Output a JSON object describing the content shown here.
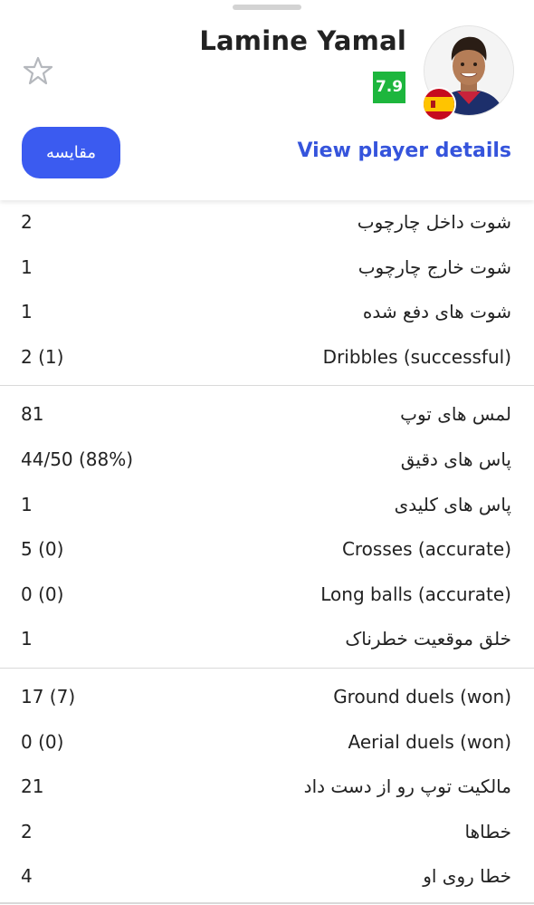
{
  "player": {
    "name": "Lamine Yamal",
    "rating": "7.9",
    "rating_color": "#1db63d",
    "nationality_flag": "spain-flag-icon"
  },
  "actions": {
    "compare_label": "مقایسه",
    "details_label": "View player details",
    "accent_color": "#3b5bf0"
  },
  "stats_groups": [
    {
      "rows": [
        {
          "label": "شوت داخل چارچوب",
          "value": "2"
        },
        {
          "label": "شوت خارج چارچوب",
          "value": "1"
        },
        {
          "label": "شوت های دفع شده",
          "value": "1"
        },
        {
          "label": "Dribbles (successful)",
          "value": "2 (1)"
        }
      ]
    },
    {
      "rows": [
        {
          "label": "لمس های توپ",
          "value": "81"
        },
        {
          "label": "پاس های دقیق",
          "value": "44/50 (88%)"
        },
        {
          "label": "پاس های کلیدی",
          "value": "1"
        },
        {
          "label": "Crosses (accurate)",
          "value": "5 (0)"
        },
        {
          "label": "Long balls (accurate)",
          "value": "0 (0)"
        },
        {
          "label": "خلق موقعیت خطرناک",
          "value": "1"
        }
      ]
    },
    {
      "rows": [
        {
          "label": "Ground duels (won)",
          "value": "17 (7)"
        },
        {
          "label": "Aerial duels (won)",
          "value": "0 (0)"
        },
        {
          "label": "مالکیت توپ رو از دست داد",
          "value": "21"
        },
        {
          "label": "خطاها",
          "value": "2"
        },
        {
          "label": "خطا روی او",
          "value": "4"
        }
      ]
    }
  ]
}
